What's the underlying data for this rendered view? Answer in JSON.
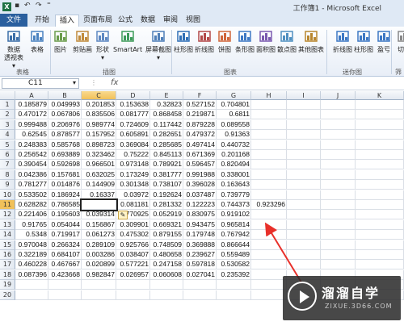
{
  "window": {
    "title": "工作簿1 - Microsoft Excel",
    "app_icon_letter": "X"
  },
  "quick_access": {
    "undo": "↶",
    "redo": "↷",
    "more": "⁼"
  },
  "tabs": [
    {
      "label": "文件",
      "kind": "file"
    },
    {
      "label": "开始"
    },
    {
      "label": "插入",
      "active": true
    },
    {
      "label": "页面布局"
    },
    {
      "label": "公式"
    },
    {
      "label": "数据"
    },
    {
      "label": "审阅"
    },
    {
      "label": "视图"
    }
  ],
  "ribbon": {
    "buttons": [
      {
        "name": "pivot-table",
        "l1": "数据",
        "l2": "透视表 ▾"
      },
      {
        "name": "table",
        "l1": "表格",
        "l2": ""
      },
      {
        "name": "picture",
        "l1": "图片",
        "l2": ""
      },
      {
        "name": "clip-art",
        "l1": "剪贴画",
        "l2": ""
      },
      {
        "name": "shapes",
        "l1": "形状",
        "l2": "▾"
      },
      {
        "name": "smartart",
        "l1": "SmartArt",
        "l2": ""
      },
      {
        "name": "screenshot",
        "l1": "屏幕截图",
        "l2": "▾"
      },
      {
        "name": "column-chart",
        "l1": "柱形图",
        "l2": ""
      },
      {
        "name": "line-chart",
        "l1": "折线图",
        "l2": ""
      },
      {
        "name": "pie-chart",
        "l1": "饼图",
        "l2": ""
      },
      {
        "name": "bar-chart",
        "l1": "条形图",
        "l2": ""
      },
      {
        "name": "area-chart",
        "l1": "面积图",
        "l2": ""
      },
      {
        "name": "scatter-chart",
        "l1": "散点图",
        "l2": ""
      },
      {
        "name": "other-charts",
        "l1": "其他图表",
        "l2": ""
      },
      {
        "name": "sparkline-line",
        "l1": "折线图",
        "l2": ""
      },
      {
        "name": "sparkline-column",
        "l1": "柱形图",
        "l2": ""
      },
      {
        "name": "sparkline-winloss",
        "l1": "盈亏",
        "l2": ""
      },
      {
        "name": "slicer",
        "l1": "切",
        "l2": ""
      }
    ],
    "groups": [
      {
        "name": "tables",
        "label": "表格"
      },
      {
        "name": "illustrations",
        "label": "插图"
      },
      {
        "name": "charts",
        "label": "图表"
      },
      {
        "name": "sparklines",
        "label": "迷你图"
      },
      {
        "name": "filter",
        "label": "筛"
      }
    ]
  },
  "formula_bar": {
    "name_box": "C11",
    "fx": "fx",
    "content": ""
  },
  "columns": [
    "A",
    "B",
    "C",
    "D",
    "E",
    "F",
    "G",
    "H",
    "I",
    "J",
    "K"
  ],
  "selected_column": "C",
  "selected_row": 11,
  "rows": [
    [
      "0.185879",
      "0.049993",
      "0.201853",
      "0.153638",
      "0.32823",
      "0.527152",
      "0.704801",
      ""
    ],
    [
      "0.470172",
      "0.067806",
      "0.835506",
      "0.081777",
      "0.868458",
      "0.219871",
      "0.6811",
      ""
    ],
    [
      "0.999488",
      "0.206976",
      "0.989774",
      "0.724609",
      "0.117442",
      "0.879228",
      "0.089558",
      ""
    ],
    [
      "0.62545",
      "0.878577",
      "0.157952",
      "0.605891",
      "0.282651",
      "0.479372",
      "0.91363",
      ""
    ],
    [
      "0.248383",
      "0.585768",
      "0.898723",
      "0.369084",
      "0.285685",
      "0.497414",
      "0.440732",
      ""
    ],
    [
      "0.256542",
      "0.693889",
      "0.323462",
      "0.75222",
      "0.845113",
      "0.671369",
      "0.201168",
      ""
    ],
    [
      "0.390454",
      "0.592698",
      "0.966501",
      "0.973148",
      "0.789921",
      "0.596457",
      "0.820494",
      ""
    ],
    [
      "0.042386",
      "0.157681",
      "0.632025",
      "0.173249",
      "0.381777",
      "0.991988",
      "0.338001",
      ""
    ],
    [
      "0.781277",
      "0.014876",
      "0.144909",
      "0.301348",
      "0.738107",
      "0.396028",
      "0.163643",
      ""
    ],
    [
      "0.533502",
      "0.186924",
      "0.16337",
      "0.03972",
      "0.192624",
      "0.037487",
      "0.739779",
      ""
    ],
    [
      "0.628282",
      "0.786585",
      "",
      "0.081181",
      "0.281332",
      "0.122223",
      "0.744373",
      "0.923296"
    ],
    [
      "0.221406",
      "0.195603",
      "0.039314",
      "0.770925",
      "0.052919",
      "0.830975",
      "0.919102",
      ""
    ],
    [
      "0.91765",
      "0.054044",
      "0.156867",
      "0.309901",
      "0.669321",
      "0.943475",
      "0.965814",
      ""
    ],
    [
      "0.5348",
      "0.719917",
      "0.061273",
      "0.475302",
      "0.879155",
      "0.179748",
      "0.767942",
      ""
    ],
    [
      "0.970048",
      "0.266324",
      "0.289109",
      "0.925766",
      "0.748509",
      "0.369888",
      "0.866644",
      ""
    ],
    [
      "0.322189",
      "0.684107",
      "0.003286",
      "0.038407",
      "0.480658",
      "0.239627",
      "0.559489",
      ""
    ],
    [
      "0.460228",
      "0.467667",
      "0.020899",
      "0.577221",
      "0.247158",
      "0.597818",
      "0.530582",
      ""
    ],
    [
      "0.087396",
      "0.423668",
      "0.982847",
      "0.026957",
      "0.060608",
      "0.027041",
      "0.235392",
      ""
    ],
    [
      "",
      "",
      "",
      "",
      "",
      "",
      "",
      ""
    ],
    [
      "",
      "",
      "",
      "",
      "",
      "",
      "",
      ""
    ]
  ],
  "annotation": {
    "arrow_color": "#e8302a"
  },
  "watermark": {
    "text": "溜溜自学",
    "url": "ZIXUE.3D66.COM"
  }
}
